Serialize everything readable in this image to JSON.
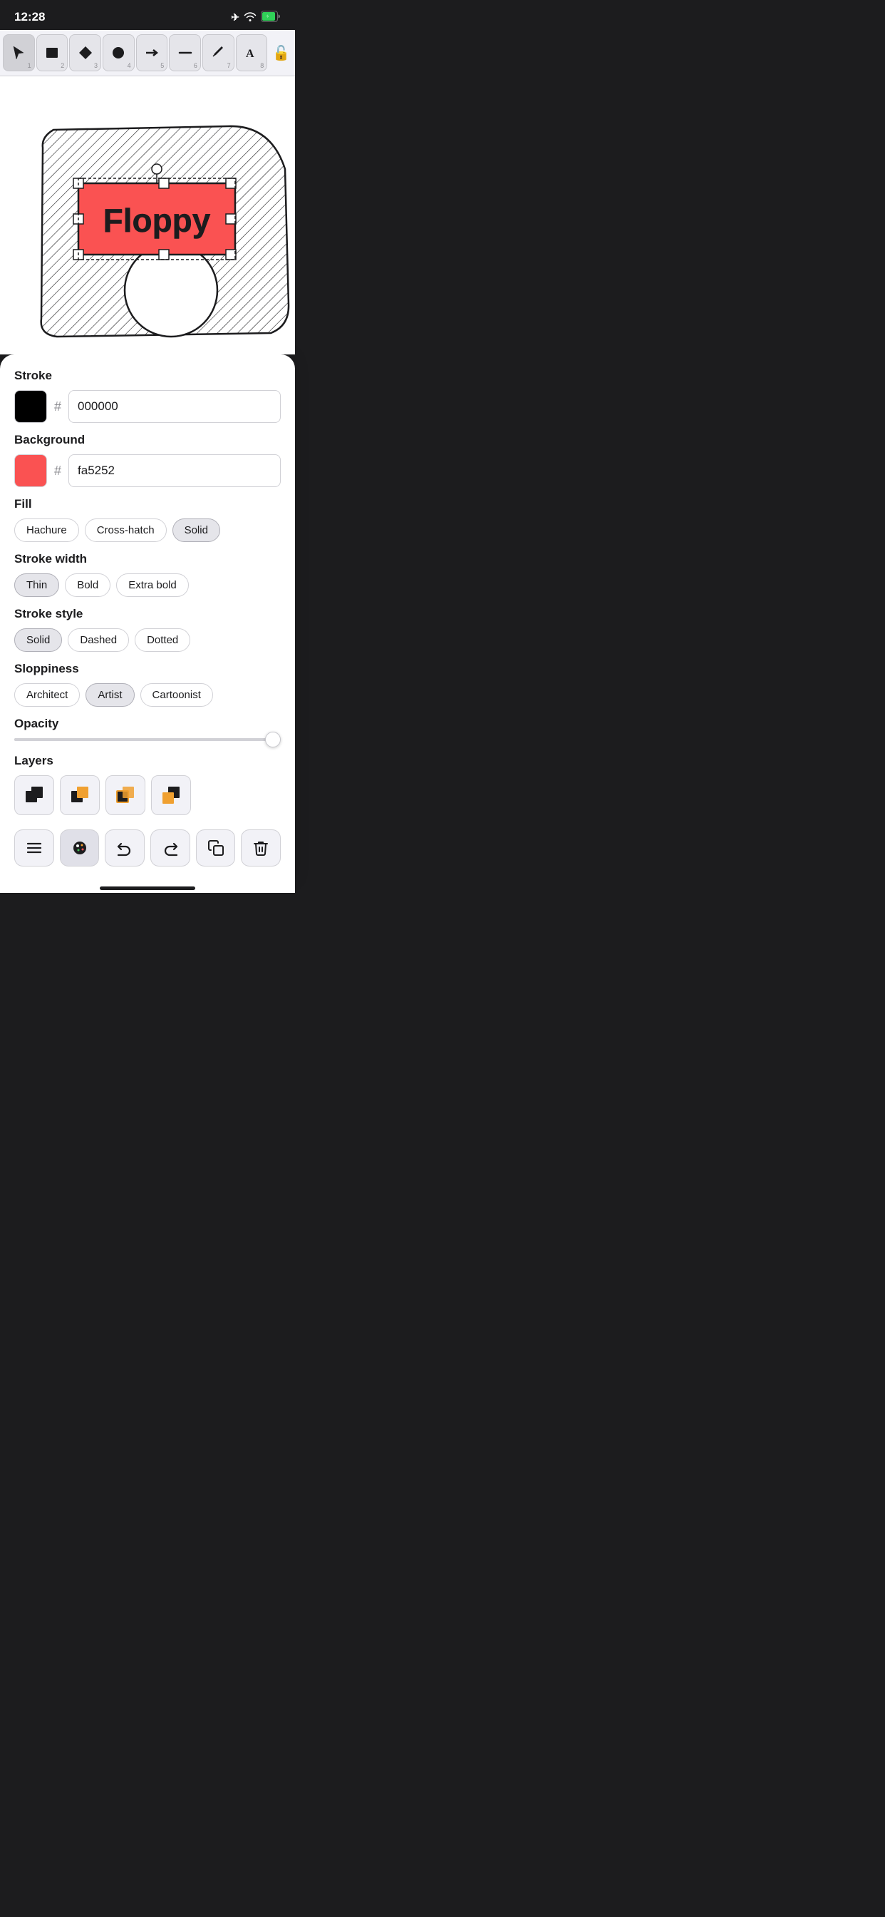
{
  "statusBar": {
    "time": "12:28",
    "locationIcon": "◁",
    "wifiIcon": "wifi",
    "batteryIcon": "battery"
  },
  "toolbar": {
    "tools": [
      {
        "id": 1,
        "icon": "cursor",
        "label": "Select",
        "active": true
      },
      {
        "id": 2,
        "icon": "square",
        "label": "Rectangle"
      },
      {
        "id": 3,
        "icon": "diamond",
        "label": "Diamond"
      },
      {
        "id": 4,
        "icon": "circle",
        "label": "Ellipse"
      },
      {
        "id": 5,
        "icon": "arrow",
        "label": "Arrow"
      },
      {
        "id": 6,
        "icon": "line",
        "label": "Line"
      },
      {
        "id": 7,
        "icon": "pencil",
        "label": "Draw"
      },
      {
        "id": 8,
        "icon": "text",
        "label": "Text"
      }
    ],
    "lockLabel": "🔓"
  },
  "panel": {
    "strokeLabel": "Stroke",
    "strokeColor": "#000000",
    "strokeHex": "000000",
    "backgroundLabel": "Background",
    "bgColor": "#fa5252",
    "bgHex": "fa5252",
    "fillLabel": "Fill",
    "fillOptions": [
      {
        "label": "Hachure",
        "active": false
      },
      {
        "label": "Cross-hatch",
        "active": false
      },
      {
        "label": "Solid",
        "active": true
      }
    ],
    "strokeWidthLabel": "Stroke width",
    "strokeWidthOptions": [
      {
        "label": "Thin",
        "active": true
      },
      {
        "label": "Bold",
        "active": false
      },
      {
        "label": "Extra bold",
        "active": false
      }
    ],
    "strokeStyleLabel": "Stroke style",
    "strokeStyleOptions": [
      {
        "label": "Solid",
        "active": true
      },
      {
        "label": "Dashed",
        "active": false
      },
      {
        "label": "Dotted",
        "active": false
      }
    ],
    "sloppinessLabel": "Sloppiness",
    "sloppinessOptions": [
      {
        "label": "Architect",
        "active": false
      },
      {
        "label": "Artist",
        "active": true
      },
      {
        "label": "Cartoonist",
        "active": false
      }
    ],
    "opacityLabel": "Opacity",
    "opacityValue": 100,
    "layersLabel": "Layers"
  },
  "bottomBar": {
    "buttons": [
      {
        "id": "menu",
        "label": "menu"
      },
      {
        "id": "style",
        "label": "style",
        "active": true
      },
      {
        "id": "undo",
        "label": "undo"
      },
      {
        "id": "redo",
        "label": "redo"
      },
      {
        "id": "copy",
        "label": "copy"
      },
      {
        "id": "delete",
        "label": "delete"
      }
    ]
  }
}
